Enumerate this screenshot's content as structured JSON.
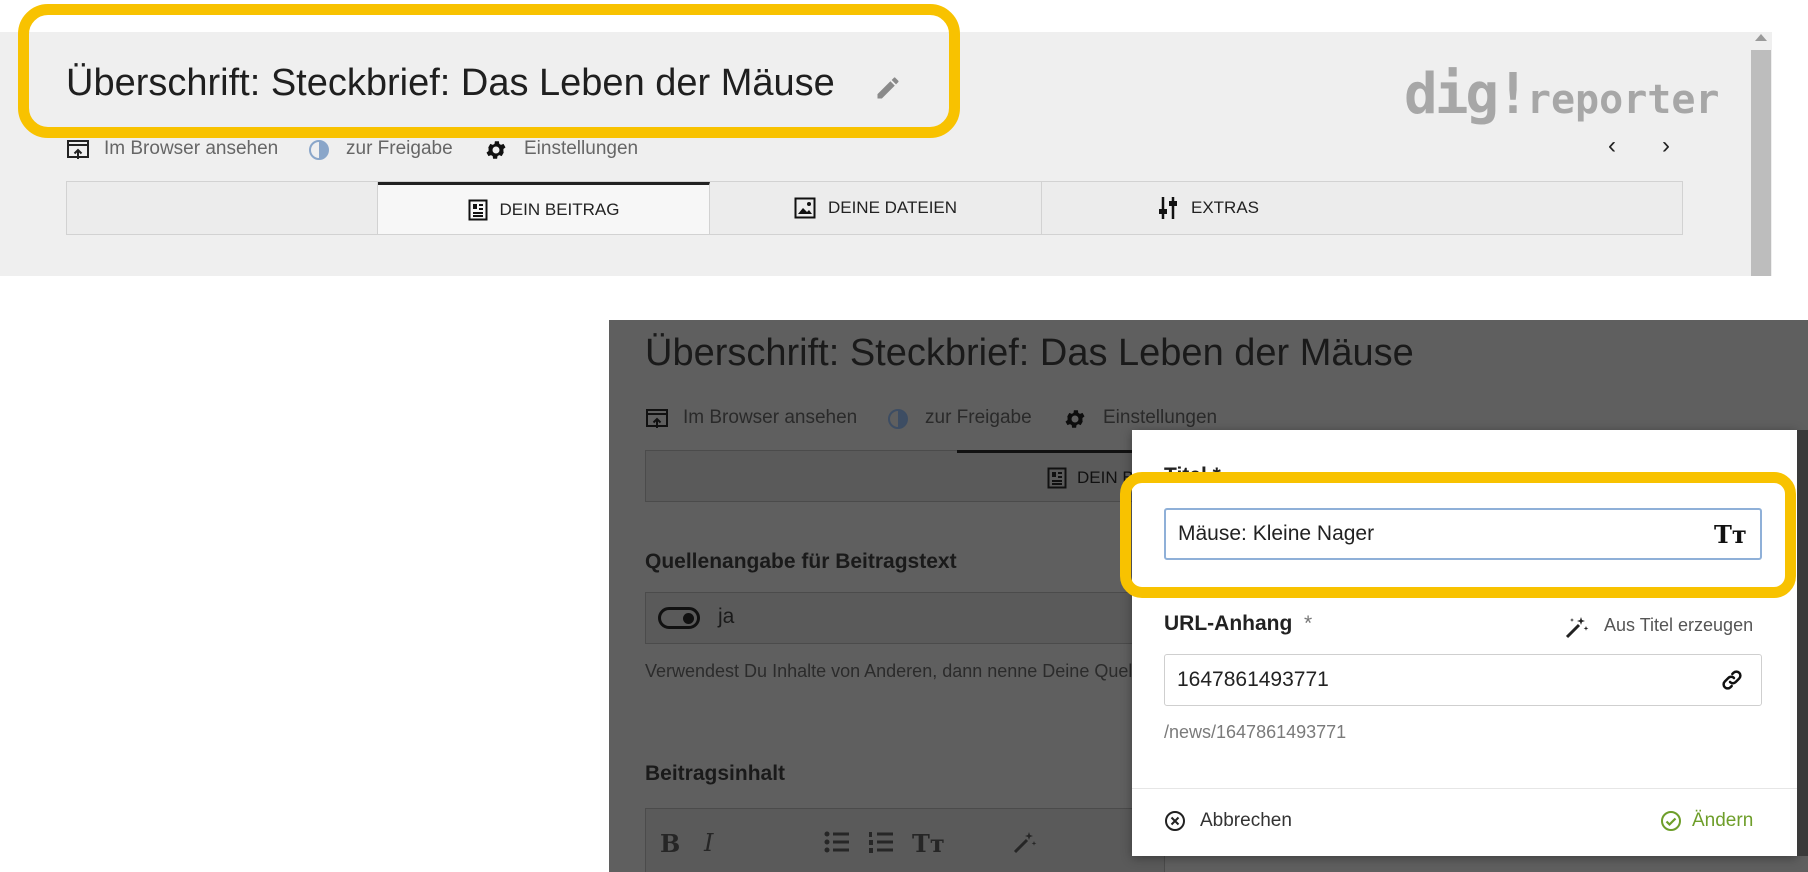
{
  "top": {
    "title": "Überschrift: Steckbrief: Das Leben der Mäuse",
    "logo_prefix": "dig!",
    "logo_suffix": "reporter",
    "actions": {
      "view_browser": "Im Browser ansehen",
      "release": "zur Freigabe",
      "settings": "Einstellungen"
    },
    "nav": {
      "prev": "‹",
      "next": "›"
    },
    "tabs": [
      {
        "label": "DEIN BEITRAG",
        "icon": "article-icon"
      },
      {
        "label": "DEINE DATEIEN",
        "icon": "image-icon"
      },
      {
        "label": "EXTRAS",
        "icon": "sliders-icon"
      }
    ]
  },
  "bottom": {
    "title": "Überschrift: Steckbrief: Das Leben der Mäuse",
    "actions": {
      "view_browser": "Im Browser ansehen",
      "release": "zur Freigabe",
      "settings": "Einstellungen"
    },
    "active_tab": "DEIN B",
    "source_label": "Quellenangabe für Beitragstext",
    "toggle_label": "ja",
    "source_help": "Verwendest Du Inhalte von Anderen, dann nenne Deine Quellen.",
    "content_label": "Beitragsinhalt"
  },
  "dialog": {
    "title_label": "Titel *",
    "title_value": "Mäuse: Kleine Nager",
    "url_label": "URL-Anhang",
    "url_required": "*",
    "generate_label": "Aus Titel erzeugen",
    "url_value": "1647861493771",
    "url_path": "/news/1647861493771",
    "cancel_label": "Abbrechen",
    "change_label": "Ändern"
  },
  "colors": {
    "highlight": "#f8c200",
    "panel_bg": "#efefef",
    "overlay_bg": "#5f5f5f",
    "confirm_green": "#6e9e2a"
  }
}
